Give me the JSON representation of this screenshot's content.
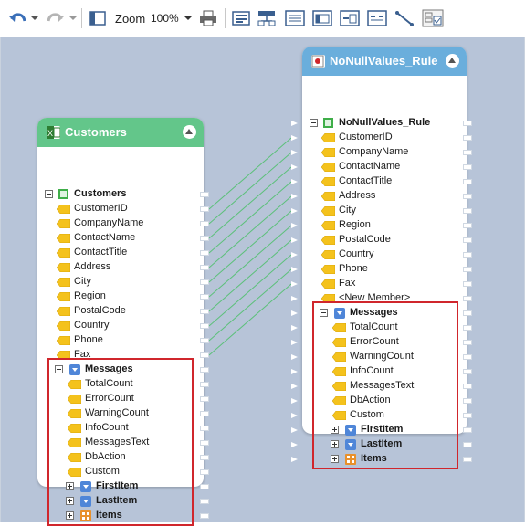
{
  "toolbar": {
    "zoom_label": "Zoom",
    "zoom_value": "100%",
    "icons": [
      "undo-icon",
      "redo-icon",
      "page-layout-icon",
      "print-icon",
      "align-icon",
      "layout-tree-icon",
      "list-icon",
      "component-icon",
      "insert-icon",
      "map-icon",
      "line-icon",
      "table-grid-icon"
    ]
  },
  "source": {
    "title": "Customers",
    "header_color": "#63c68a",
    "root": "Customers",
    "fields": [
      "CustomerID",
      "CompanyName",
      "ContactName",
      "ContactTitle",
      "Address",
      "City",
      "Region",
      "PostalCode",
      "Country",
      "Phone",
      "Fax"
    ],
    "messages": {
      "label": "Messages",
      "children": [
        "TotalCount",
        "ErrorCount",
        "WarningCount",
        "InfoCount",
        "MessagesText",
        "DbAction",
        "Custom"
      ],
      "collapsed": [
        "FirstItem",
        "LastItem",
        "Items"
      ]
    }
  },
  "target": {
    "title": "NoNullValues_Rule",
    "header_color": "#6aaedc",
    "root": "NoNullValues_Rule",
    "fields": [
      "CustomerID",
      "CompanyName",
      "ContactName",
      "ContactTitle",
      "Address",
      "City",
      "Region",
      "PostalCode",
      "Country",
      "Phone",
      "Fax",
      "<New Member>"
    ],
    "messages": {
      "label": "Messages",
      "children": [
        "TotalCount",
        "ErrorCount",
        "WarningCount",
        "InfoCount",
        "MessagesText",
        "DbAction",
        "Custom"
      ],
      "collapsed": [
        "FirstItem",
        "LastItem",
        "Items"
      ]
    }
  },
  "colors": {
    "canvas": "#b7c4d8",
    "link": "#5cc07a",
    "highlight": "#d0262c",
    "tag": "#f4c21c"
  }
}
